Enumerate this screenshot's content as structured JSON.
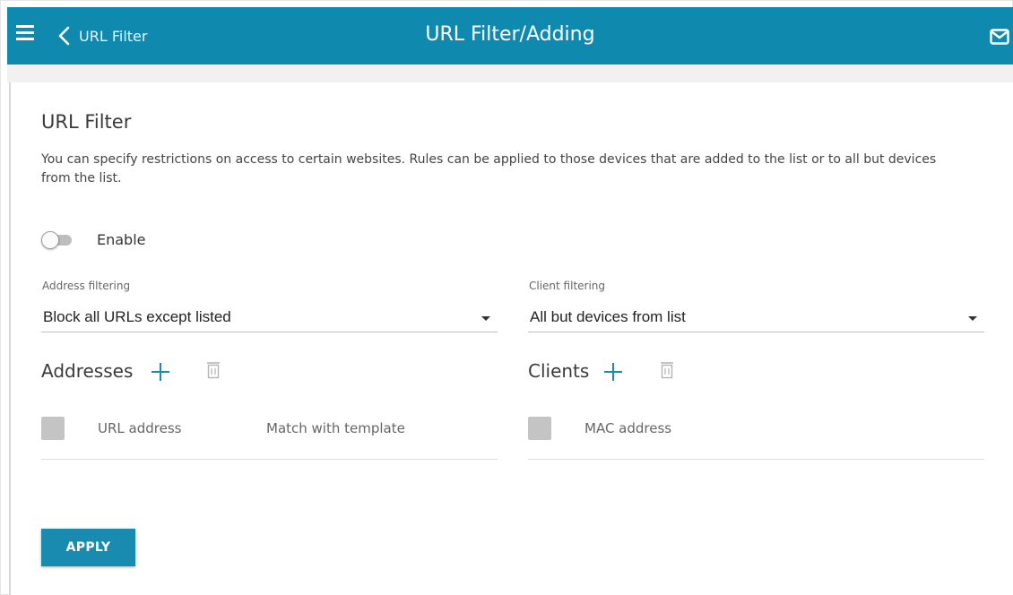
{
  "header": {
    "back_label": "URL Filter",
    "title": "URL Filter/Adding",
    "menu_icon": "hamburger-icon",
    "back_icon": "chevron-left-icon",
    "mail_icon": "envelope-icon",
    "bar_color": "#0f8aae"
  },
  "main": {
    "title": "URL Filter",
    "description": "You can specify restrictions on access to certain websites. Rules can be applied to those devices that are added to the list or to all but devices from the list.",
    "enable_label": "Enable",
    "enable_state": false,
    "address_filtering": {
      "label": "Address filtering",
      "value": "Block all URLs except listed"
    },
    "client_filtering": {
      "label": "Client filtering",
      "value": "All but devices from list"
    },
    "addresses": {
      "title": "Addresses",
      "columns": [
        "URL address",
        "Match with template"
      ]
    },
    "clients": {
      "title": "Clients",
      "columns": [
        "MAC address"
      ]
    },
    "apply_label": "APPLY",
    "accent_color": "#1a8bb0"
  }
}
